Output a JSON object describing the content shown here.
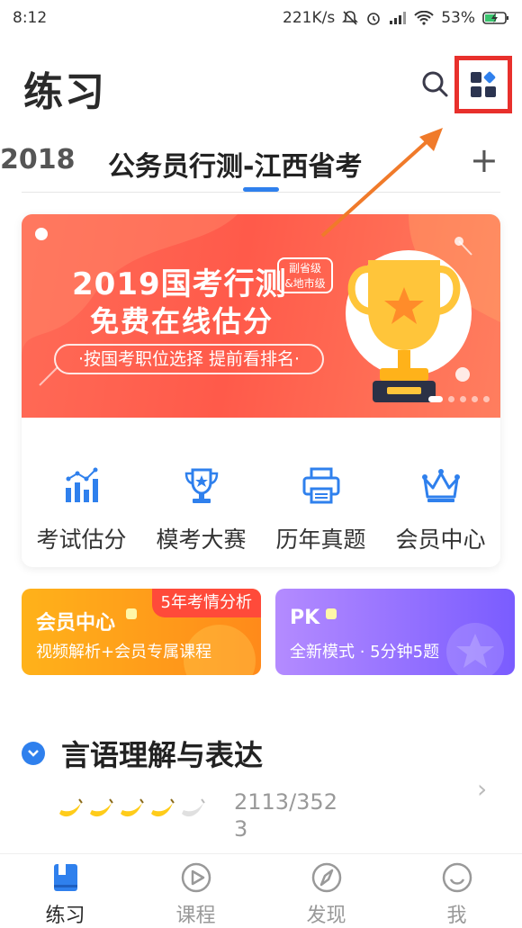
{
  "status": {
    "time": "8:12",
    "net_speed": "221K/s",
    "battery": "53%"
  },
  "header": {
    "title": "练习",
    "search_icon": "search-icon",
    "grid_icon": "grid-apps-icon"
  },
  "tabs": {
    "partial_left": "2018",
    "active": "公务员行测-江西省考",
    "add": "+"
  },
  "banner": {
    "title": "2019国考行测",
    "subtitle": "免费在线估分",
    "tag_line1": "副省级",
    "tag_line2": "&地市级",
    "pill": "·按国考职位选择  提前看排名·"
  },
  "menu": [
    {
      "label": "考试估分",
      "icon": "chart-bars-icon"
    },
    {
      "label": "模考大赛",
      "icon": "trophy-icon"
    },
    {
      "label": "历年真题",
      "icon": "printer-icon"
    },
    {
      "label": "会员中心",
      "icon": "crown-icon"
    }
  ],
  "promo": {
    "vip": {
      "title": "会员中心",
      "badge": "5年考情分析",
      "desc": "视频解析+会员专属课程"
    },
    "pk": {
      "title": "PK",
      "desc": "全新模式 · 5分钟5题"
    }
  },
  "section": {
    "title": "言语理解与表达",
    "progress": "2113/3523",
    "bananas_filled": 4,
    "bananas_total": 5
  },
  "bottom_nav": [
    {
      "label": "练习",
      "icon": "book-icon",
      "active": true
    },
    {
      "label": "课程",
      "icon": "play-circle-icon",
      "active": false
    },
    {
      "label": "发现",
      "icon": "compass-icon",
      "active": false
    },
    {
      "label": "我",
      "icon": "smile-face-icon",
      "active": false
    }
  ],
  "colors": {
    "accent": "#2f80ed",
    "highlight_box": "#e8302c",
    "arrow": "#f07a2a"
  }
}
